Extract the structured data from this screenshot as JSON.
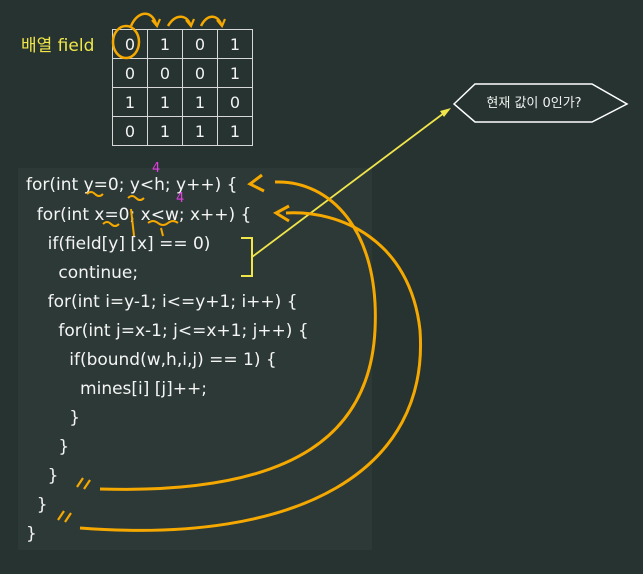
{
  "array_label": "배열 field",
  "grid": [
    [
      "0",
      "1",
      "0",
      "1"
    ],
    [
      "0",
      "0",
      "0",
      "1"
    ],
    [
      "1",
      "1",
      "1",
      "0"
    ],
    [
      "0",
      "1",
      "1",
      "1"
    ]
  ],
  "code_lines": [
    "for(int y=0; y<h; y++) {",
    "  for(int x=0; x<w; x++) {",
    "    if(field[y] [x] == 0)",
    "      continue;",
    "    for(int i=y-1; i<=y+1; i++) {",
    "      for(int j=x-1; j<=x+1; j++) {",
    "        if(bound(w,h,i,j) == 1) {",
    "          mines[i] [j]++;",
    "        }",
    "      }",
    "    }",
    "  }",
    "}"
  ],
  "annotations": {
    "h_value": "4",
    "w_value": "4"
  },
  "callout": "현재 값이 0인가?",
  "colors": {
    "background": "#263331",
    "highlight": "#f0e64a",
    "ink": "#f5a800",
    "annotation": "#e040e0"
  }
}
